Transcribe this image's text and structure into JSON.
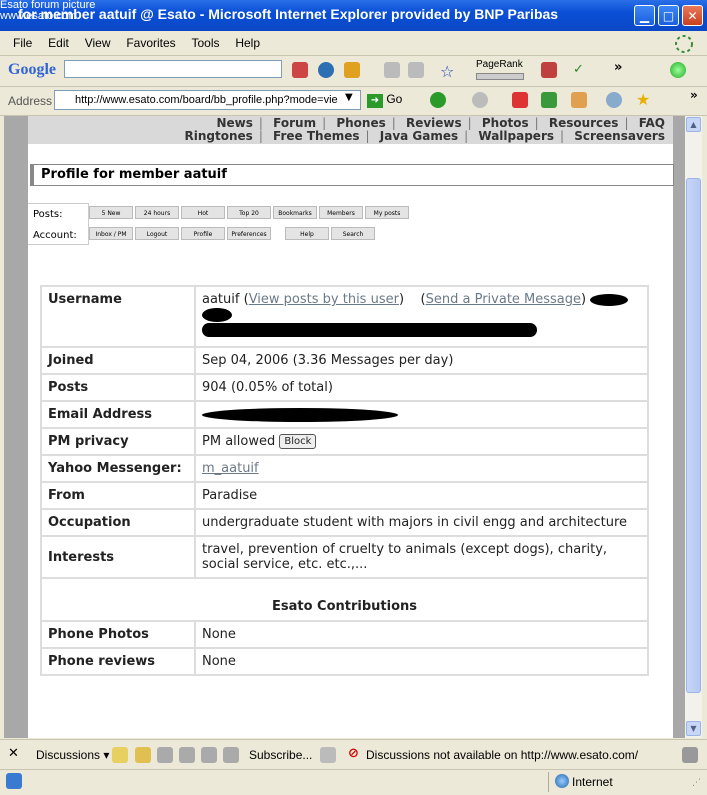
{
  "window": {
    "title": "for member aatuif @ Esato - Microsoft Internet Explorer provided by BNP Paribas",
    "overlay_line1": "Esato forum picture",
    "overlay_line2": "www.esato.com"
  },
  "menu": [
    "File",
    "Edit",
    "View",
    "Favorites",
    "Tools",
    "Help"
  ],
  "google_toolbar": {
    "logo": "Google",
    "search_value": "",
    "pagerank_label": "PageRank"
  },
  "address": {
    "label": "Address",
    "url": "http://www.esato.com/board/bb_profile.php?mode=vie",
    "go_label": "Go"
  },
  "site_nav": {
    "row1": [
      "News",
      "Forum",
      "Phones",
      "Reviews",
      "Photos",
      "Resources",
      "FAQ"
    ],
    "row2": [
      "Ringtones",
      "Free Themes",
      "Java Games",
      "Wallpapers",
      "Screensavers"
    ]
  },
  "profile_title": "Profile for member aatuif",
  "subnav": {
    "posts_label": "Posts:",
    "posts_buttons": [
      "5 New",
      "24 hours",
      "Hot",
      "Top 20",
      "Bookmarks",
      "Members",
      "My posts"
    ],
    "account_label": "Account:",
    "account_buttons": [
      "Inbox / PM",
      "Logout",
      "Profile",
      "Preferences",
      "Help",
      "Search"
    ]
  },
  "profile": {
    "username_label": "Username",
    "username": "aatuif",
    "view_posts_link": "View posts by this user",
    "send_pm_link": "Send a Private Message",
    "joined_label": "Joined",
    "joined": "Sep 04, 2006 (3.36 Messages per day)",
    "posts_label": "Posts",
    "posts": "904 (0.05% of total)",
    "email_label": "Email Address",
    "pm_privacy_label": "PM privacy",
    "pm_privacy": "PM allowed",
    "block_label": "Block",
    "yahoo_label": "Yahoo Messenger:",
    "yahoo": "m_aatuif",
    "from_label": "From",
    "from": "Paradise",
    "occupation_label": "Occupation",
    "occupation": "undergraduate student with majors in civil engg and architecture",
    "interests_label": "Interests",
    "interests": "travel, prevention of cruelty to animals (except dogs), charity, social service, etc. etc.,...",
    "contributions_heading": "Esato Contributions",
    "phone_photos_label": "Phone Photos",
    "phone_photos": "None",
    "phone_reviews_label": "Phone reviews",
    "phone_reviews": "None"
  },
  "discussions_bar": {
    "discussions_label": "Discussions",
    "subscribe_label": "Subscribe...",
    "status_msg": "Discussions not available on http://www.esato.com/"
  },
  "statusbar": {
    "zone": "Internet"
  }
}
